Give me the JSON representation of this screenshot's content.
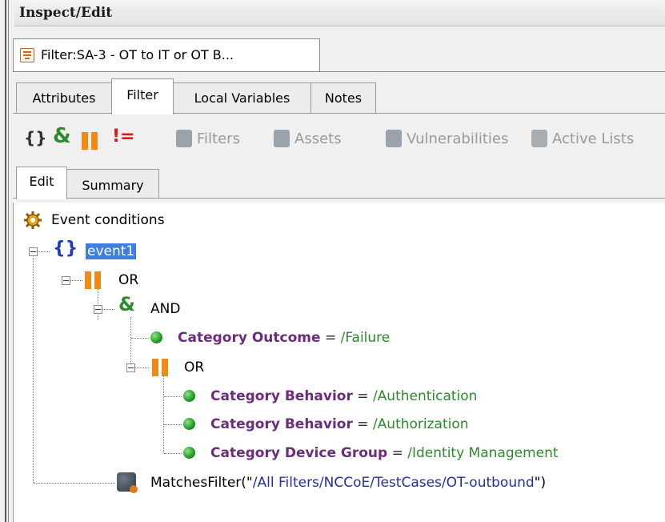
{
  "panel": {
    "title": "Inspect/Edit"
  },
  "doc_tab": {
    "label": "Filter:SA-3 - OT to IT or OT B..."
  },
  "tabs": [
    {
      "label": "Attributes"
    },
    {
      "label": "Filter"
    },
    {
      "label": "Local Variables"
    },
    {
      "label": "Notes"
    }
  ],
  "toolbar": {
    "filters": "Filters",
    "assets": "Assets",
    "vulnerabilities": "Vulnerabilities",
    "active_lists": "Active Lists",
    "not_equal_symbol": "!=",
    "and_symbol": "&",
    "brace_symbol": "{}"
  },
  "subtabs": [
    {
      "label": "Edit"
    },
    {
      "label": "Summary"
    }
  ],
  "tree": {
    "root": "Event conditions",
    "event": "event1",
    "or1": "OR",
    "and1": "AND",
    "cond_outcome": {
      "field": "Category Outcome",
      "op": "=",
      "value": "/Failure"
    },
    "or2": "OR",
    "cond_behavior1": {
      "field": "Category Behavior",
      "op": "=",
      "value": "/Authentication"
    },
    "cond_behavior2": {
      "field": "Category Behavior",
      "op": "=",
      "value": "/Authorization"
    },
    "cond_device": {
      "field": "Category Device Group",
      "op": "=",
      "value": "/Identity Management"
    },
    "matches": {
      "func": "MatchesFilter(\"",
      "path": "/All Filters/NCCoE/TestCases/OT-outbound",
      "close": "\")"
    }
  }
}
